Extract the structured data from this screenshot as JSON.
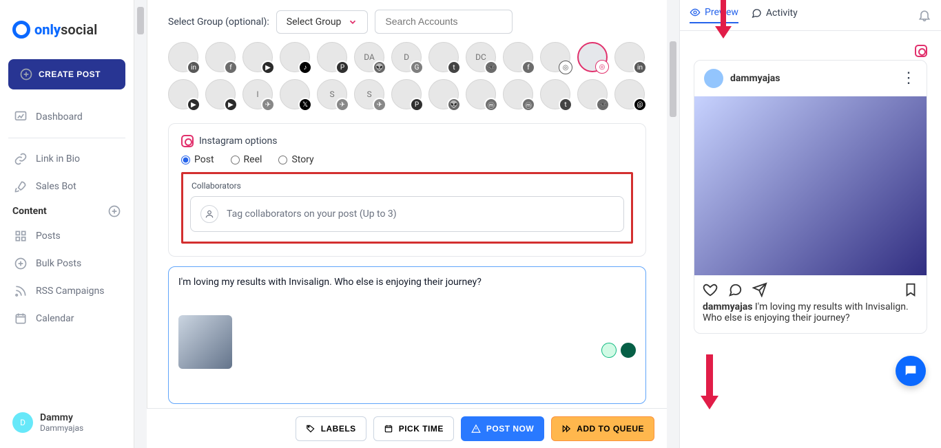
{
  "brand": {
    "name_bold": "only",
    "name_rest": "social"
  },
  "sidebar": {
    "create": "CREATE POST",
    "dashboard": "Dashboard",
    "linkinbio": "Link in Bio",
    "salesbot": "Sales Bot",
    "content_header": "Content",
    "posts": "Posts",
    "bulkposts": "Bulk Posts",
    "rss": "RSS Campaigns",
    "calendar": "Calendar"
  },
  "user": {
    "initial": "D",
    "name": "Dammy",
    "handle": "Dammyajas"
  },
  "group": {
    "label": "Select Group (optional):",
    "button": "Select Group",
    "search_placeholder": "Search Accounts"
  },
  "instagram": {
    "title": "Instagram options",
    "post": "Post",
    "reel": "Reel",
    "story": "Story",
    "collab_label": "Collaborators",
    "collab_placeholder": "Tag collaborators on your post (Up to 3)"
  },
  "composer": {
    "text": "I'm loving my results with Invisalign. Who else is enjoying their journey?"
  },
  "actions": {
    "labels": "LABELS",
    "picktime": "PICK TIME",
    "postnow": "POST NOW",
    "queue": "ADD TO QUEUE"
  },
  "right": {
    "preview": "Preview",
    "activity": "Activity",
    "ig_user": "dammyajas",
    "ig_caption_user": "dammyajas",
    "ig_caption_text": "I'm loving my results with Invisalign. Who else is enjoying their journey?"
  },
  "accounts_row1_badges": [
    "li",
    "fb",
    "yt",
    "tt",
    "pi",
    "re",
    "gb",
    "tu",
    "bs",
    "fb",
    "ig",
    "ig",
    "li"
  ],
  "accounts_row2_badges": [
    "yt",
    "yt",
    "tg",
    "x",
    "tg",
    "tg",
    "pi",
    "re",
    "ma",
    "ma",
    "tu",
    "bs",
    "th"
  ],
  "accounts_row1_avtext": [
    "",
    "",
    "",
    "",
    "",
    "DA",
    "D",
    "",
    "DC",
    "",
    "",
    "",
    ""
  ],
  "accounts_row2_avtext": [
    "",
    "",
    "I",
    "",
    "S",
    "S",
    "",
    "",
    "",
    "",
    "",
    "",
    ""
  ],
  "selected_account_index_row1": 11
}
